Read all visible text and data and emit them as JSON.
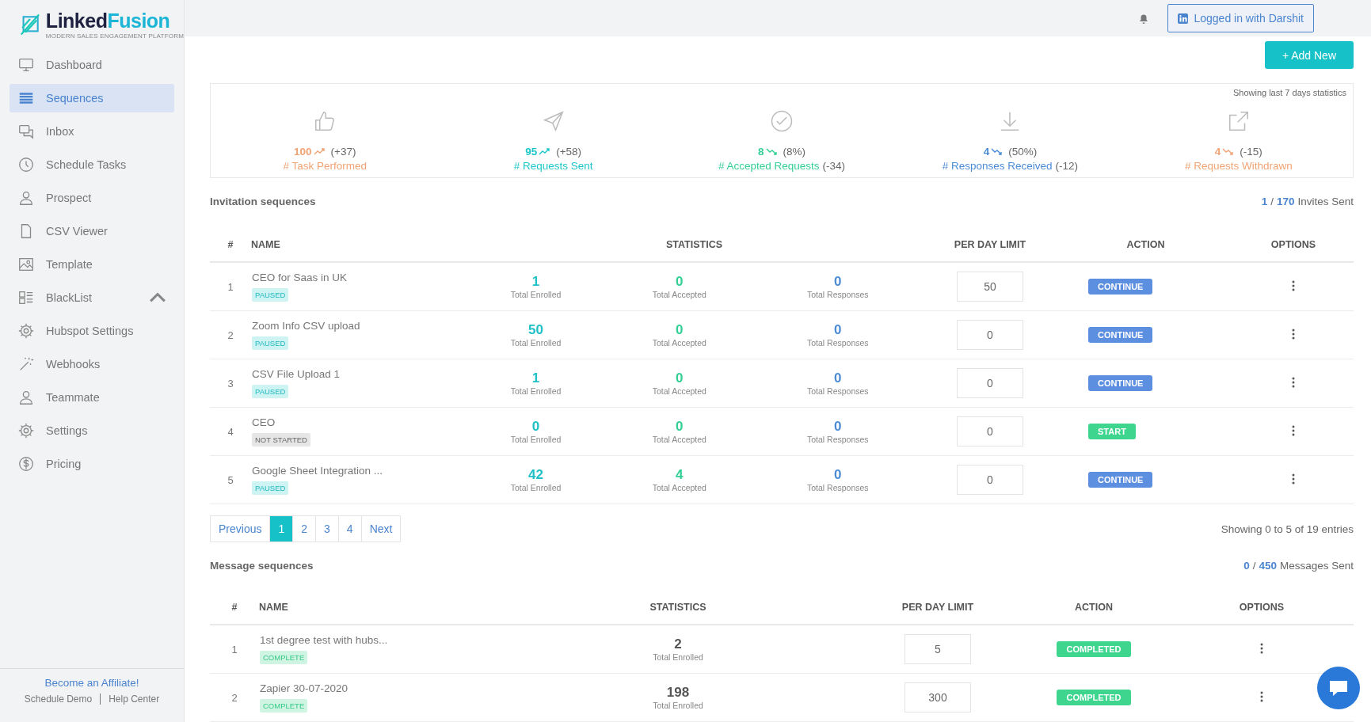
{
  "brand": {
    "name_part_1": "Linked",
    "name_part_2": "Fusion",
    "tagline": "MODERN SALES ENGAGEMENT PLATFORM"
  },
  "sidebar": {
    "items": [
      {
        "label": "Dashboard",
        "selected": false,
        "submenu": false
      },
      {
        "label": "Sequences",
        "selected": true,
        "submenu": false
      },
      {
        "label": "Inbox",
        "selected": false,
        "submenu": false
      },
      {
        "label": "Schedule Tasks",
        "selected": false,
        "submenu": false
      },
      {
        "label": "Prospect",
        "selected": false,
        "submenu": false
      },
      {
        "label": "CSV Viewer",
        "selected": false,
        "submenu": false
      },
      {
        "label": "Template",
        "selected": false,
        "submenu": false
      },
      {
        "label": "BlackList",
        "selected": false,
        "submenu": true
      },
      {
        "label": "Hubspot Settings",
        "selected": false,
        "submenu": false
      },
      {
        "label": "Webhooks",
        "selected": false,
        "submenu": false
      },
      {
        "label": "Teammate",
        "selected": false,
        "submenu": false
      },
      {
        "label": "Settings",
        "selected": false,
        "submenu": false
      },
      {
        "label": "Pricing",
        "selected": false,
        "submenu": false
      }
    ],
    "footer": {
      "affiliate": "Become an Affiliate!",
      "links": [
        "Schedule Demo",
        "Help Center"
      ]
    }
  },
  "header": {
    "login_button": "Logged in with Darshit"
  },
  "add_button": "+ Add New",
  "stats": {
    "note": "Showing last 7 days statistics",
    "items": [
      {
        "value": "100",
        "rising": true,
        "delta": "(+37)",
        "label": "# Task Performed",
        "color": "#f0a374"
      },
      {
        "value": "95",
        "rising": true,
        "delta": "(+58)",
        "label": "# Requests Sent",
        "color": "#1cc6c9"
      },
      {
        "value": "8",
        "rising": false,
        "delta": "(8%)",
        "label": "# Accepted Requests",
        "suffix": "(-34)",
        "color": "#34cf95"
      },
      {
        "value": "4",
        "rising": false,
        "delta": "(50%)",
        "label": "# Responses Received",
        "suffix": "(-12)",
        "color": "#4b8bd6"
      },
      {
        "value": "4",
        "rising": false,
        "delta": "(-15)",
        "label": "# Requests Withdrawn",
        "color": "#f0a374"
      }
    ]
  },
  "invitation": {
    "title": "Invitation sequences",
    "sent_count": "1",
    "separator": "/",
    "sent_total": "170",
    "sent_label": "Invites Sent",
    "columns": [
      "#",
      "NAME",
      "STATISTICS",
      "PER DAY LIMIT",
      "ACTION",
      "OPTIONS"
    ],
    "rows": [
      {
        "num": "1",
        "name": "CEO for Saas in UK",
        "status": "PAUSED",
        "started": true,
        "enrolled": "1",
        "enrolled_label": "Total Enrolled",
        "accepted": "0",
        "accepted_label": "Total Accepted",
        "responses": "0",
        "responses_label": "Total Responses",
        "limit": "50",
        "action": "CONTINUE"
      },
      {
        "num": "2",
        "name": "Zoom Info CSV upload",
        "status": "PAUSED",
        "started": true,
        "enrolled": "50",
        "enrolled_label": "Total Enrolled",
        "accepted": "0",
        "accepted_label": "Total Accepted",
        "responses": "0",
        "responses_label": "Total Responses",
        "limit": "0",
        "action": "CONTINUE"
      },
      {
        "num": "3",
        "name": "CSV File Upload 1",
        "status": "PAUSED",
        "started": true,
        "enrolled": "1",
        "enrolled_label": "Total Enrolled",
        "accepted": "0",
        "accepted_label": "Total Accepted",
        "responses": "0",
        "responses_label": "Total Responses",
        "limit": "0",
        "action": "CONTINUE"
      },
      {
        "num": "4",
        "name": "CEO",
        "status": "NOT STARTED",
        "started": false,
        "enrolled": "0",
        "enrolled_label": "Total Enrolled",
        "accepted": "0",
        "accepted_label": "Total Accepted",
        "responses": "0",
        "responses_label": "Total Responses",
        "limit": "0",
        "action": "START"
      },
      {
        "num": "5",
        "name": "Google Sheet Integration ...",
        "status": "PAUSED",
        "started": true,
        "enrolled": "42",
        "enrolled_label": "Total Enrolled",
        "accepted": "4",
        "accepted_label": "Total Accepted",
        "responses": "0",
        "responses_label": "Total Responses",
        "limit": "0",
        "action": "CONTINUE"
      }
    ],
    "pagination": {
      "previous": "Previous",
      "next": "Next",
      "pages": [
        {
          "label": "1",
          "selected": true
        },
        {
          "label": "2",
          "selected": false
        },
        {
          "label": "3",
          "selected": false
        },
        {
          "label": "4",
          "selected": false
        }
      ]
    },
    "entries": "Showing 0 to 5 of 19 entries"
  },
  "messages": {
    "title": "Message sequences",
    "sent_count": "0",
    "separator": "/",
    "sent_total": "450",
    "sent_label": "Messages Sent",
    "columns": [
      "#",
      "NAME",
      "STATISTICS",
      "PER DAY LIMIT",
      "ACTION",
      "OPTIONS"
    ],
    "rows": [
      {
        "num": "1",
        "name": "1st degree test with hubs...",
        "status": "COMPLETE",
        "enrolled": "2",
        "enrolled_label": "Total Enrolled",
        "limit": "5",
        "action": "COMPLETED"
      },
      {
        "num": "2",
        "name": "Zapier 30-07-2020",
        "status": "COMPLETE",
        "enrolled": "198",
        "enrolled_label": "Total Enrolled",
        "limit": "300",
        "action": "COMPLETED"
      }
    ]
  }
}
